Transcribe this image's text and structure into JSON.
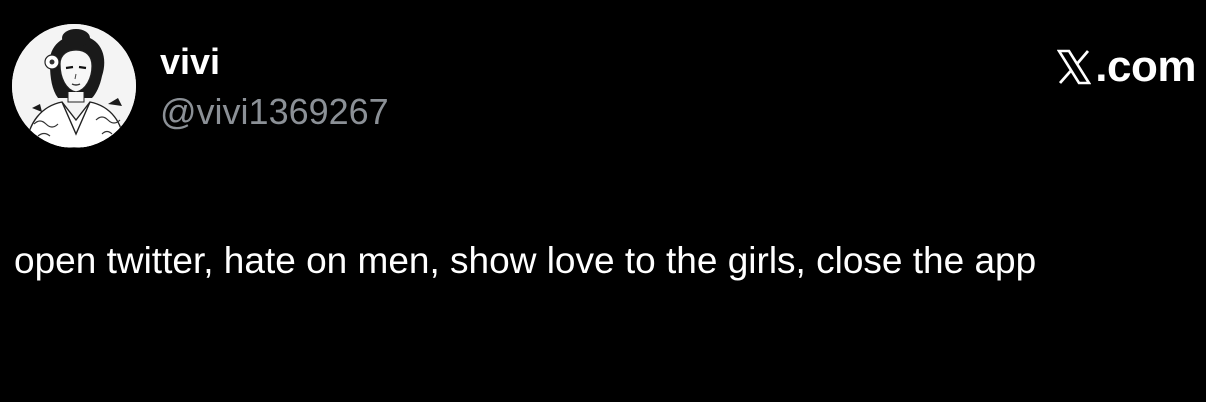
{
  "author": {
    "display_name": "vivi",
    "handle": "@vivi1369267",
    "avatar_icon": "profile-avatar-illustration"
  },
  "brand": {
    "icon": "x-logo-icon",
    "label": ".com"
  },
  "post": {
    "text": "open twitter, hate on men, show love to the girls, close the app"
  },
  "colors": {
    "background": "#000000",
    "primary_text": "#ffffff",
    "secondary_text": "#8b9096"
  }
}
